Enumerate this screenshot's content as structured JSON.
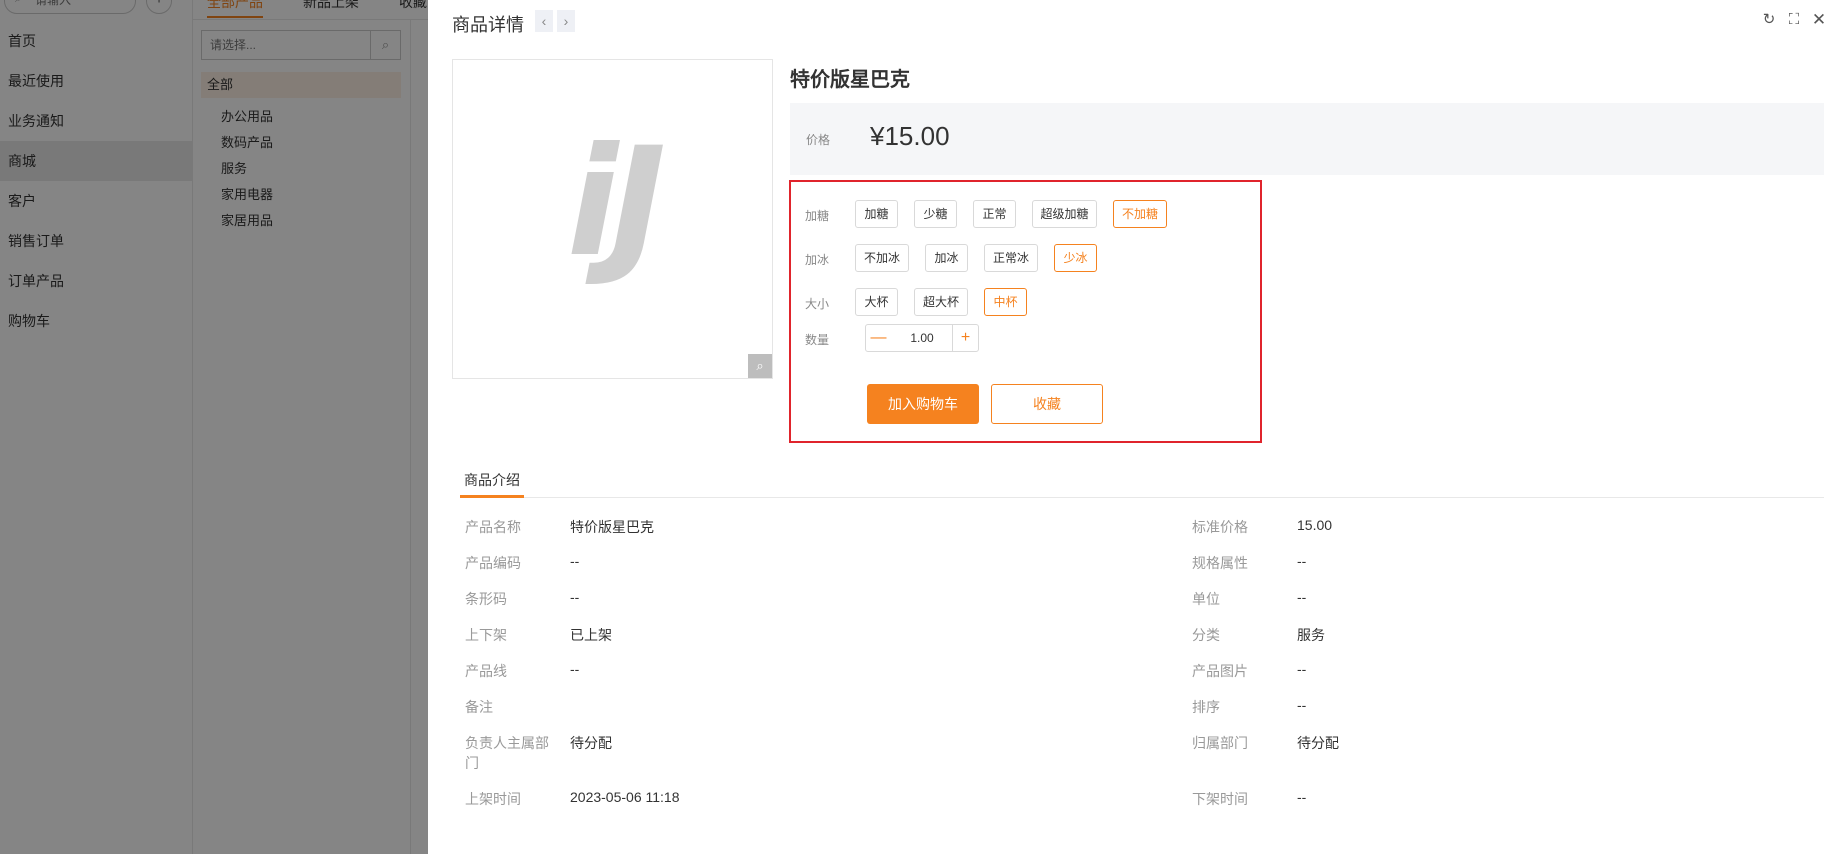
{
  "background": {
    "search_placeholder": "请输入",
    "add_icon": "+",
    "nav": [
      "首页",
      "最近使用",
      "业务通知",
      "商城",
      "客户",
      "销售订单",
      "订单产品",
      "购物车"
    ],
    "tabs": [
      "全部产品",
      "新品上架",
      "收藏"
    ],
    "category_select_placeholder": "请选择...",
    "category_all": "全部",
    "categories": [
      "办公用品",
      "数码产品",
      "服务",
      "家用电器",
      "家居用品"
    ]
  },
  "drawer": {
    "title": "商品详情",
    "prev_icon": "‹",
    "next_icon": "›",
    "refresh_icon": "↻",
    "fullscreen_icon": "⛶",
    "close_icon": "✕"
  },
  "product": {
    "image_logo": "iJ",
    "zoom_icon": "⌕",
    "name": "特价版星巴克",
    "price_label": "价格",
    "price": "¥15.00"
  },
  "options": {
    "sugar": {
      "label": "加糖",
      "choices": [
        "加糖",
        "少糖",
        "正常",
        "超级加糖",
        "不加糖"
      ],
      "selected": "不加糖"
    },
    "ice": {
      "label": "加冰",
      "choices": [
        "不加冰",
        "加冰",
        "正常冰",
        "少冰"
      ],
      "selected": "少冰"
    },
    "size": {
      "label": "大小",
      "choices": [
        "大杯",
        "超大杯",
        "中杯"
      ],
      "selected": "中杯"
    },
    "quantity": {
      "label": "数量",
      "value": "1.00",
      "minus": "—",
      "plus": "+"
    },
    "add_to_cart": "加入购物车",
    "favorite": "收藏"
  },
  "intro": {
    "tab": "商品介绍",
    "left_fields": [
      {
        "label": "产品名称",
        "value": "特价版星巴克"
      },
      {
        "label": "产品编码",
        "value": "--"
      },
      {
        "label": "条形码",
        "value": "--"
      },
      {
        "label": "上下架",
        "value": "已上架"
      },
      {
        "label": "产品线",
        "value": "--"
      },
      {
        "label": "备注",
        "value": ""
      },
      {
        "label": "负责人主属部门",
        "value": "待分配"
      },
      {
        "label": "上架时间",
        "value": "2023-05-06 11:18"
      }
    ],
    "right_fields": [
      {
        "label": "标准价格",
        "value": "15.00"
      },
      {
        "label": "规格属性",
        "value": "--"
      },
      {
        "label": "单位",
        "value": "--"
      },
      {
        "label": "分类",
        "value": "服务"
      },
      {
        "label": "产品图片",
        "value": "--"
      },
      {
        "label": "排序",
        "value": "--"
      },
      {
        "label": "归属部门",
        "value": "待分配"
      },
      {
        "label": "下架时间",
        "value": "--"
      }
    ]
  },
  "colors": {
    "accent": "#f5821f",
    "highlight_border": "#e0242c"
  }
}
